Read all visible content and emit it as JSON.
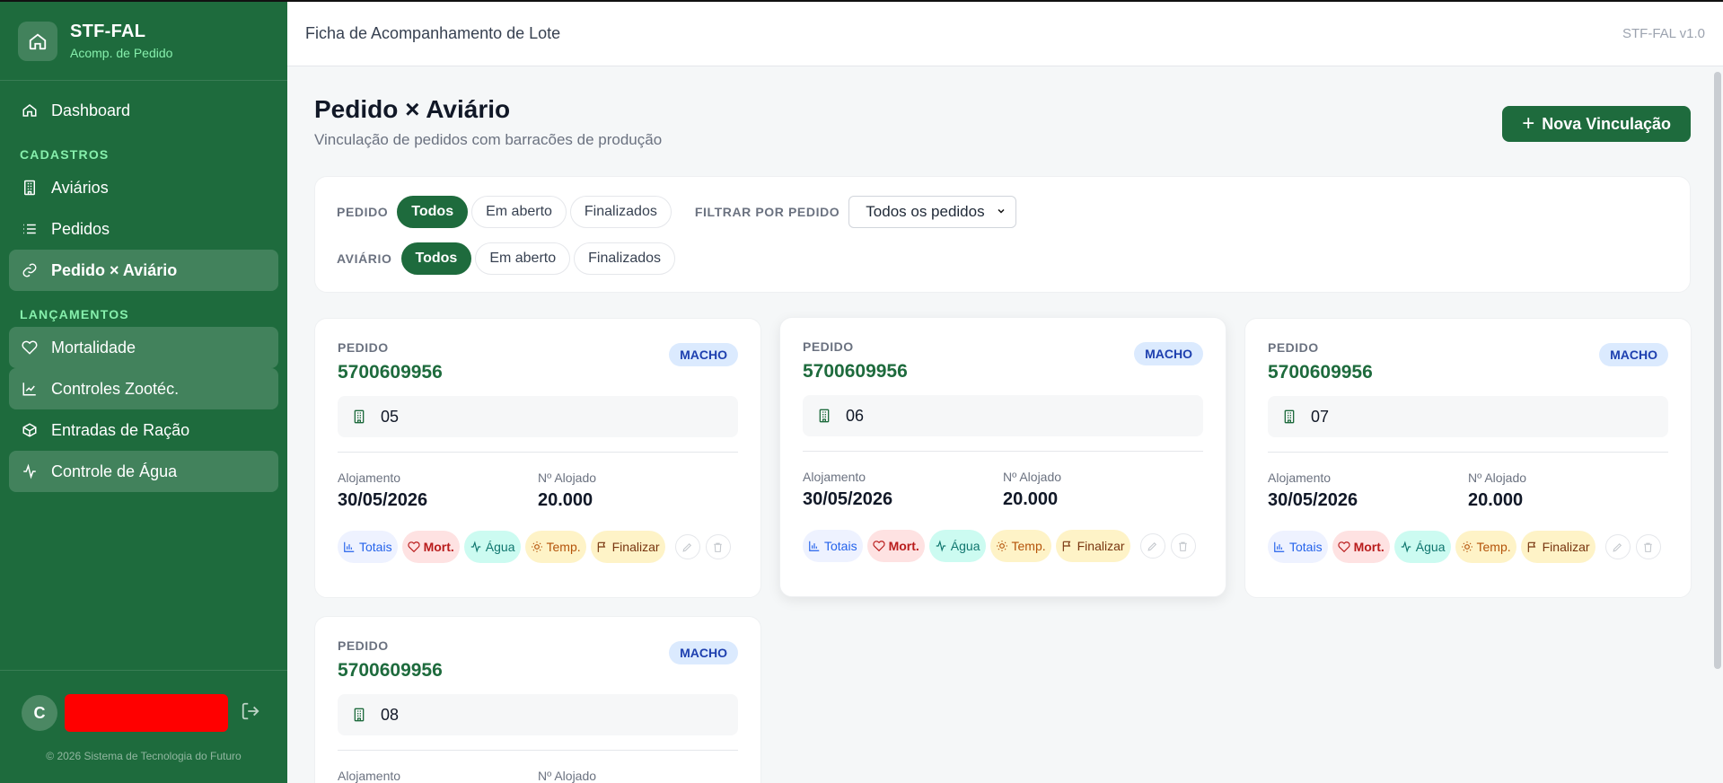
{
  "app": {
    "name": "STF-FAL",
    "subtitle": "Acomp. de Pedido",
    "version": "STF-FAL v1.0",
    "topbar_title": "Ficha de Acompanhamento de Lote"
  },
  "sidebar": {
    "dashboard": "Dashboard",
    "section_cadastros": "CADASTROS",
    "avarios": "Aviários",
    "pedidos": "Pedidos",
    "pedido_aviario": "Pedido × Aviário",
    "section_lancamentos": "LANÇAMENTOS",
    "mortalidade": "Mortalidade",
    "controles": "Controles Zootéc.",
    "entradas": "Entradas de Ração",
    "agua": "Controle de Água",
    "user_initial": "C",
    "copyright": "© 2026 Sistema de Tecnologia do Futuro"
  },
  "page": {
    "title": "Pedido × Aviário",
    "subtitle": "Vinculação de pedidos com barracões de produção",
    "new_button": "Nova Vinculação"
  },
  "filters": {
    "pedido_label": "PEDIDO",
    "aviario_label": "AVIÁRIO",
    "options": [
      "Todos",
      "Em aberto",
      "Finalizados"
    ],
    "filter_by_label": "FILTRAR POR PEDIDO",
    "select_value": "Todos os pedidos"
  },
  "card_labels": {
    "pedido": "PEDIDO",
    "alojamento": "Alojamento",
    "alojado": "Nº Alojado",
    "totais": "Totais",
    "mort": "Mort.",
    "agua": "Água",
    "temp": "Temp.",
    "finalizar": "Finalizar"
  },
  "cards": [
    {
      "pedido": "5700609956",
      "sexo": "MACHO",
      "aviario": "05",
      "alojamento": "30/05/2026",
      "alojado": "20.000"
    },
    {
      "pedido": "5700609956",
      "sexo": "MACHO",
      "aviario": "06",
      "alojamento": "30/05/2026",
      "alojado": "20.000"
    },
    {
      "pedido": "5700609956",
      "sexo": "MACHO",
      "aviario": "07",
      "alojamento": "30/05/2026",
      "alojado": "20.000"
    },
    {
      "pedido": "5700609956",
      "sexo": "MACHO",
      "aviario": "08",
      "alojamento": "",
      "alojado": ""
    }
  ],
  "card_partial_labels": {
    "alojamento": "Alojamento",
    "alojado": "Nº Alojado"
  },
  "colors": {
    "primary": "#1e6b3d",
    "accent_light": "#86efac",
    "badge_bg": "#dbeafe"
  }
}
